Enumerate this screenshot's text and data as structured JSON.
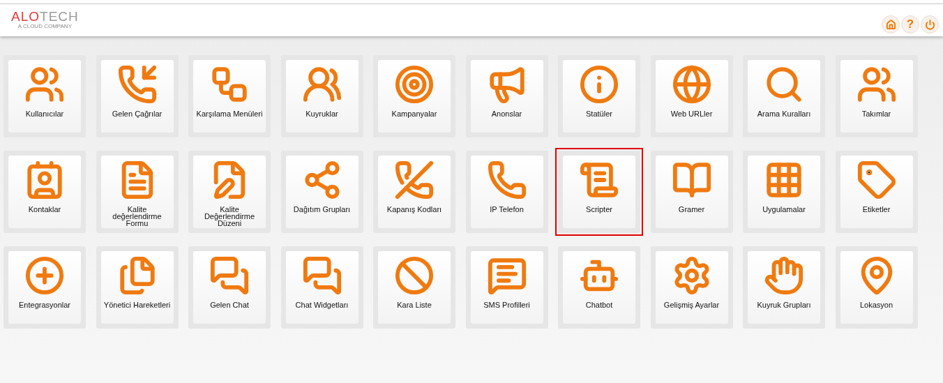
{
  "header": {
    "logo": {
      "brand_red": "ALO",
      "brand_grey": "TECH",
      "tagline": "A CLOUD COMPANY"
    },
    "help_label": "?"
  },
  "tiles": [
    {
      "label": "Kullanıcılar",
      "selected": false
    },
    {
      "label": "Gelen Çağrılar",
      "selected": false
    },
    {
      "label": "Karşılama Menüleri",
      "selected": false
    },
    {
      "label": "Kuyruklar",
      "selected": false
    },
    {
      "label": "Kampanyalar",
      "selected": false
    },
    {
      "label": "Anonslar",
      "selected": false
    },
    {
      "label": "Statüler",
      "selected": false
    },
    {
      "label": "Web URLler",
      "selected": false
    },
    {
      "label": "Arama Kuralları",
      "selected": false
    },
    {
      "label": "Takımlar",
      "selected": false
    },
    {
      "label": "Kontaklar",
      "selected": false
    },
    {
      "label": "Kalite değerlendirme Formu",
      "selected": false
    },
    {
      "label": "Kalite Değerlendirme Düzeni",
      "selected": false
    },
    {
      "label": "Dağıtım Grupları",
      "selected": false
    },
    {
      "label": "Kapanış Kodları",
      "selected": false
    },
    {
      "label": "IP Telefon",
      "selected": false
    },
    {
      "label": "Scripter",
      "selected": true
    },
    {
      "label": "Gramer",
      "selected": false
    },
    {
      "label": "Uygulamalar",
      "selected": false
    },
    {
      "label": "Etiketler",
      "selected": false
    },
    {
      "label": "Entegrasyonlar",
      "selected": false
    },
    {
      "label": "Yönetici Hareketleri",
      "selected": false
    },
    {
      "label": "Gelen Chat",
      "selected": false
    },
    {
      "label": "Chat Widgetları",
      "selected": false
    },
    {
      "label": "Kara Liste",
      "selected": false
    },
    {
      "label": "SMS Profilleri",
      "selected": false
    },
    {
      "label": "Chatbot",
      "selected": false
    },
    {
      "label": "Gelişmiş Ayarlar",
      "selected": false
    },
    {
      "label": "Kuyruk Grupları",
      "selected": false
    },
    {
      "label": "Lokasyon",
      "selected": false
    }
  ]
}
